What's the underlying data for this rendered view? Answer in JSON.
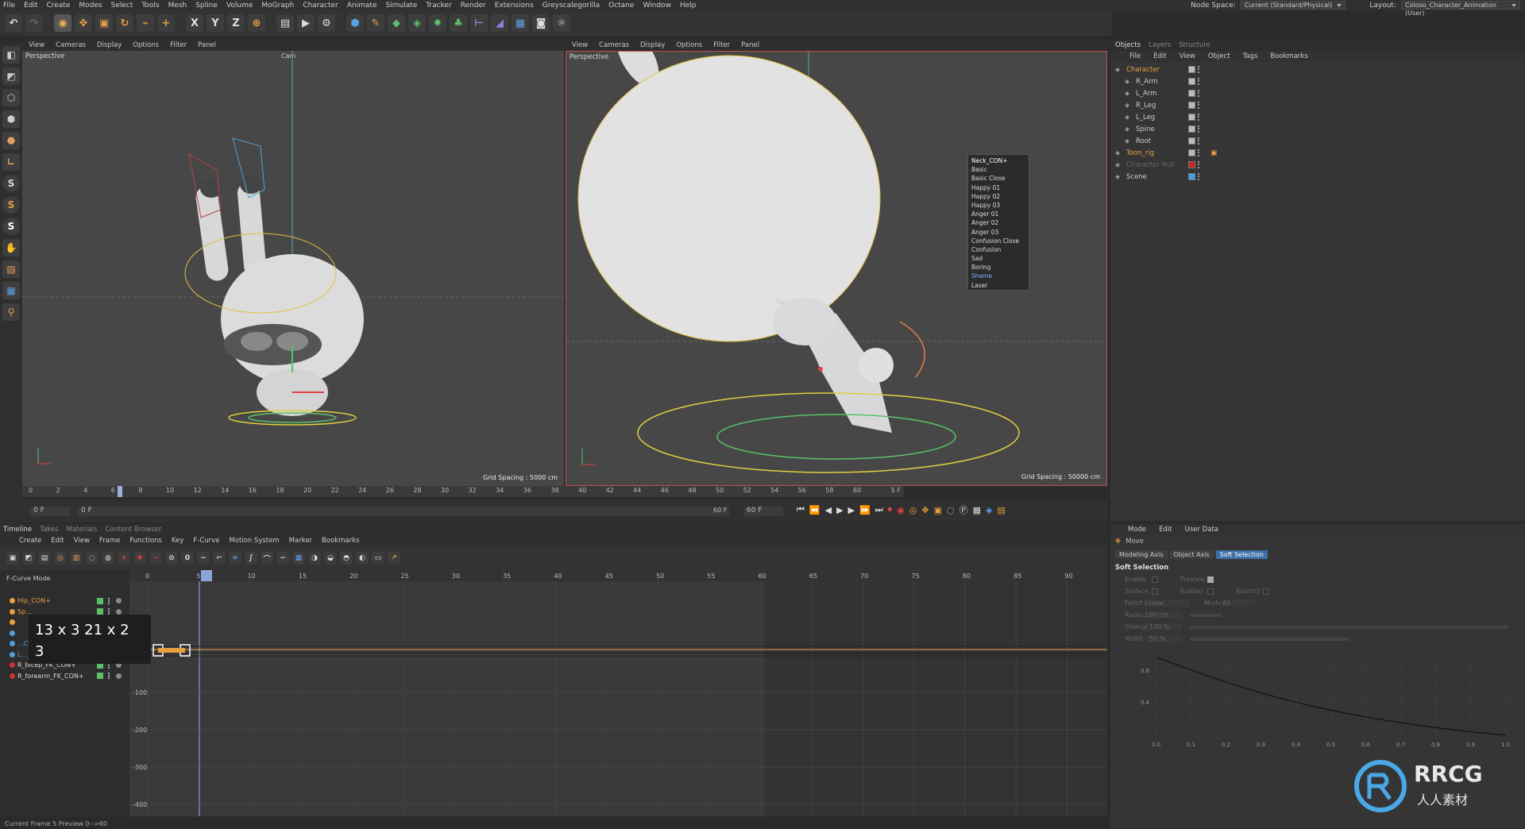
{
  "menubar": {
    "items": [
      "File",
      "Edit",
      "Create",
      "Modes",
      "Select",
      "Tools",
      "Mesh",
      "Spline",
      "Volume",
      "MoGraph",
      "Character",
      "Animate",
      "Simulate",
      "Tracker",
      "Render",
      "Extensions",
      "Greyscalegorilla",
      "Octane",
      "Window",
      "Help"
    ],
    "node_space_label": "Node Space:",
    "node_space_value": "Current (Standard/Physical)",
    "layout_label": "Layout:",
    "layout_value": "Coloso_Character_Animation (User)"
  },
  "toolbar": {
    "axis_x": "X",
    "axis_y": "Y",
    "axis_z": "Z"
  },
  "leftcol": {
    "s1": "S",
    "s2": "S",
    "s3": "S"
  },
  "viewport_left": {
    "menu": [
      "View",
      "Cameras",
      "Display",
      "Options",
      "Filter",
      "Panel"
    ],
    "label": "Perspective",
    "camera_label": "Cam",
    "grid_spacing": "Grid Spacing : 5000 cm"
  },
  "viewport_right": {
    "menu": [
      "View",
      "Cameras",
      "Display",
      "Options",
      "Filter",
      "Panel"
    ],
    "label": "Perspective",
    "grid_spacing": "Grid Spacing : 50000 cm"
  },
  "face_menu": {
    "title": "Neck_CON+",
    "items": [
      "Basic",
      "Basic Close",
      "Happy 01",
      "Happy 02",
      "Happy 03",
      "Anger 01",
      "Anger 02",
      "Anger 03",
      "Confusion Close",
      "Confusion",
      "Sad",
      "Boring",
      "Shame",
      "Laser"
    ],
    "highlight": "Shame"
  },
  "ruler": {
    "ticks": [
      "0",
      "2",
      "4",
      "6",
      "8",
      "10",
      "12",
      "14",
      "16",
      "18",
      "20",
      "22",
      "24",
      "26",
      "28",
      "30",
      "32",
      "34",
      "36",
      "38",
      "40",
      "42",
      "44",
      "46",
      "48",
      "50",
      "52",
      "54",
      "56",
      "58",
      "60"
    ],
    "current_frame_marker": "5 F"
  },
  "playbar": {
    "start": "0 F",
    "current": "0 F",
    "end": "60 F",
    "end2": "60 F"
  },
  "objects_panel": {
    "tabs": [
      "Objects",
      "Layers",
      "Structure"
    ],
    "menu": [
      "File",
      "Edit",
      "View",
      "Object",
      "Tags",
      "Bookmarks"
    ],
    "items": [
      {
        "name": "Character",
        "color": "#e8a040"
      },
      {
        "name": "R_Arm",
        "color": "#cccccc"
      },
      {
        "name": "L_Arm",
        "color": "#cccccc"
      },
      {
        "name": "R_Leg",
        "color": "#cccccc"
      },
      {
        "name": "L_Leg",
        "color": "#cccccc"
      },
      {
        "name": "Spine",
        "color": "#cccccc"
      },
      {
        "name": "Root",
        "color": "#cccccc"
      },
      {
        "name": "Toon_rig",
        "color": "#e8a040"
      },
      {
        "name": "Character Null",
        "color": "#666666"
      },
      {
        "name": "Scene",
        "color": "#cccccc"
      }
    ]
  },
  "attributes": {
    "menu": [
      "Mode",
      "Edit",
      "User Data"
    ],
    "tool": "Move",
    "tabs": [
      "Modeling Axis",
      "Object Axis",
      "Soft Selection"
    ],
    "section": "Soft Selection",
    "props": {
      "enable": "Enable",
      "preview": "Preview",
      "surface": "Surface",
      "rubber": "Rubber",
      "restrict": "Restrict",
      "falloff": "Falloff",
      "falloff_val": "Linear",
      "mode": "Mode",
      "mode_val": "All",
      "radius": "Radius",
      "radius_val": "100 cm",
      "strength": "Strength",
      "strength_val": "100 %",
      "width": "Width",
      "width_val": "50 %"
    },
    "curve_y": [
      "0.8",
      "0.4"
    ],
    "curve_x": [
      "0.0",
      "0.1",
      "0.2",
      "0.3",
      "0.4",
      "0.5",
      "0.6",
      "0.7",
      "0.8",
      "0.9",
      "1.0"
    ]
  },
  "timeline": {
    "tabs": [
      "Timeline",
      "Takes",
      "Materials",
      "Content Browser"
    ],
    "menu": [
      "Create",
      "Edit",
      "View",
      "Frame",
      "Functions",
      "Key",
      "F-Curve",
      "Motion System",
      "Marker",
      "Bookmarks"
    ],
    "mode_label": "F-Curve Mode",
    "frame_ticks": [
      "0",
      "5",
      "10",
      "15",
      "20",
      "25",
      "30",
      "35",
      "40",
      "45",
      "50",
      "55",
      "60",
      "65",
      "70",
      "75",
      "80",
      "85",
      "90"
    ],
    "value_ticks": [
      "-100",
      "-200",
      "-300",
      "-400"
    ],
    "tracks": [
      {
        "name": "Hip_CON+",
        "color": "#e8a040"
      },
      {
        "name": "Sp...",
        "color": "#e8a040"
      },
      {
        "name": "",
        "color": "#e8a040"
      },
      {
        "name": "",
        "color": "#4aa0e0"
      },
      {
        "name": "...CON+",
        "color": "#4aa0e0"
      },
      {
        "name": "L..._FK_CON+",
        "color": "#4aa0e0"
      },
      {
        "name": "R_bicep_FK_CON+",
        "color": "#cc3333"
      },
      {
        "name": "R_forearm_FK_CON+",
        "color": "#cc3333"
      }
    ],
    "tooltip_line1": "13 x 3 21 x 2",
    "tooltip_line2": "3"
  },
  "statusbar": {
    "text": "Current Frame  5  Preview  0-->60"
  },
  "watermark": {
    "brand": "RRCG",
    "sub": "人人素材"
  }
}
